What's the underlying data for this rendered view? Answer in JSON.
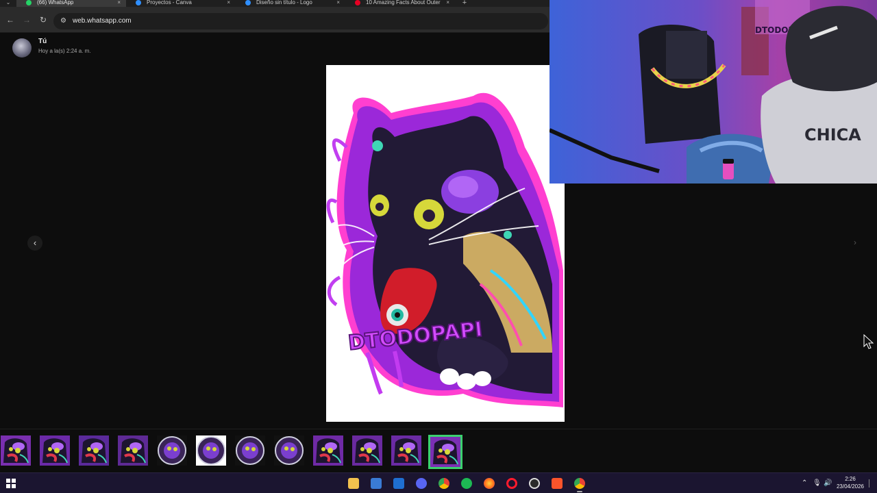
{
  "browser": {
    "tabs": [
      {
        "label": "(66) WhatsApp",
        "active": true,
        "icon": "whatsapp-icon",
        "color": "#25d366"
      },
      {
        "label": "Proyectos - Canva",
        "active": false,
        "icon": "canva-icon",
        "color": "#2f8fff"
      },
      {
        "label": "Diseño sin título - Logo",
        "active": false,
        "icon": "canva-icon",
        "color": "#2f8fff"
      },
      {
        "label": "10 Amazing Facts About Outer",
        "active": false,
        "icon": "pinterest-icon",
        "color": "#e60023"
      }
    ],
    "close_glyph": "×",
    "new_tab_glyph": "+",
    "url": "web.whatsapp.com"
  },
  "viewer": {
    "sender_name": "Tú",
    "sender_time": "Hoy a la(s) 2:24 a. m.",
    "prev_glyph": "‹",
    "next_glyph": "›",
    "sticker_text": "DTODOPAPI",
    "thumbnail_count": 12,
    "selected_thumbnail": 12
  },
  "webcam": {
    "banner_text": "DTODOP",
    "shirt_text": "CHICA"
  },
  "taskbar": {
    "time": "2:26",
    "date": "23/04/2026",
    "apps": [
      "file-explorer-icon",
      "microsoft-store-icon",
      "outlook-icon",
      "discord-icon",
      "chrome-icon",
      "spotify-icon",
      "firefox-icon",
      "opera-icon",
      "obs-icon",
      "brave-icon",
      "chrome-active-icon"
    ]
  },
  "colors": {
    "accent_green": "#3bd16f",
    "sticker_purple": "#b22ad9",
    "sticker_pink": "#e846c6"
  }
}
